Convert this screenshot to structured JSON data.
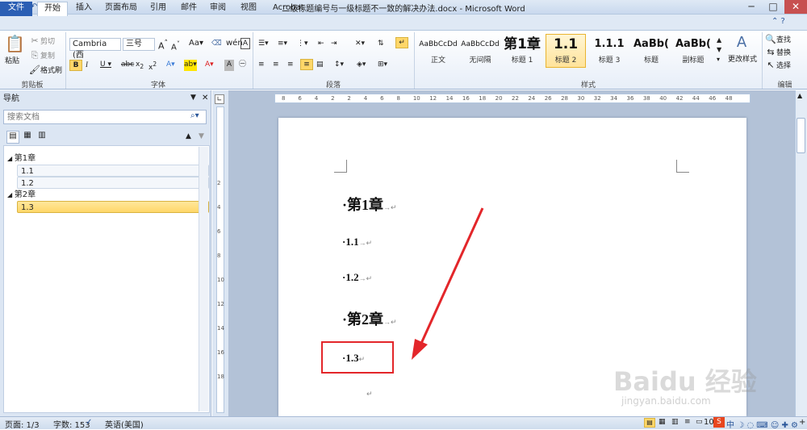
{
  "window": {
    "title": "二级标题编号与一级标题不一致的解决办法.docx - Microsoft Word"
  },
  "tabs": [
    "文件",
    "开始",
    "插入",
    "页面布局",
    "引用",
    "邮件",
    "审阅",
    "视图",
    "Acrobat"
  ],
  "clipboard": {
    "paste": "粘贴",
    "cut": "剪切",
    "copy": "复制",
    "format_painter": "格式刷",
    "label": "剪贴板"
  },
  "font": {
    "name": "Cambria (西",
    "size": "三号",
    "label": "字体"
  },
  "paragraph": {
    "label": "段落"
  },
  "styles": {
    "items": [
      {
        "preview": "AaBbCcDd",
        "name": "正文"
      },
      {
        "preview": "AaBbCcDd",
        "name": "无间隔"
      },
      {
        "preview": "第1章",
        "name": "标题 1"
      },
      {
        "preview": "1.1",
        "name": "标题 2"
      },
      {
        "preview": "1.1.1",
        "name": "标题 3"
      },
      {
        "preview": "AaBb(",
        "name": "标题"
      },
      {
        "preview": "AaBb(",
        "name": "副标题"
      }
    ],
    "change": "更改样式",
    "label": "样式"
  },
  "editing": {
    "find": "查找",
    "replace": "替换",
    "select": "选择",
    "label": "编辑"
  },
  "nav": {
    "title": "导航",
    "search_placeholder": "搜索文档",
    "tree": [
      {
        "label": "第1章"
      },
      {
        "label": "1.1"
      },
      {
        "label": "1.2"
      },
      {
        "label": "第2章"
      },
      {
        "label": "1.3"
      }
    ]
  },
  "ruler": {
    "ticks": [
      "8",
      "6",
      "4",
      "2",
      "2",
      "4",
      "6",
      "8",
      "10",
      "12",
      "14",
      "16",
      "18",
      "20",
      "22",
      "24",
      "26",
      "28",
      "30",
      "32",
      "34",
      "36",
      "38",
      "40",
      "42",
      "44",
      "46",
      "48"
    ]
  },
  "vruler": {
    "ticks": [
      "2",
      "4",
      "6",
      "8",
      "10",
      "12",
      "14",
      "16",
      "18"
    ]
  },
  "document": {
    "lines": [
      {
        "text": "第1章",
        "level": 1
      },
      {
        "text": "1.1",
        "level": 2
      },
      {
        "text": "1.2",
        "level": 2
      },
      {
        "text": "第2章",
        "level": 1
      },
      {
        "text": "1.3",
        "level": 2
      }
    ]
  },
  "status": {
    "page": "页面: 1/3",
    "words": "字数: 153",
    "language": "英语(美国)",
    "zoom": "10"
  },
  "colors": {
    "accent": "#2b579a",
    "highlight": "#ffd769",
    "annotation": "#e3262a"
  }
}
